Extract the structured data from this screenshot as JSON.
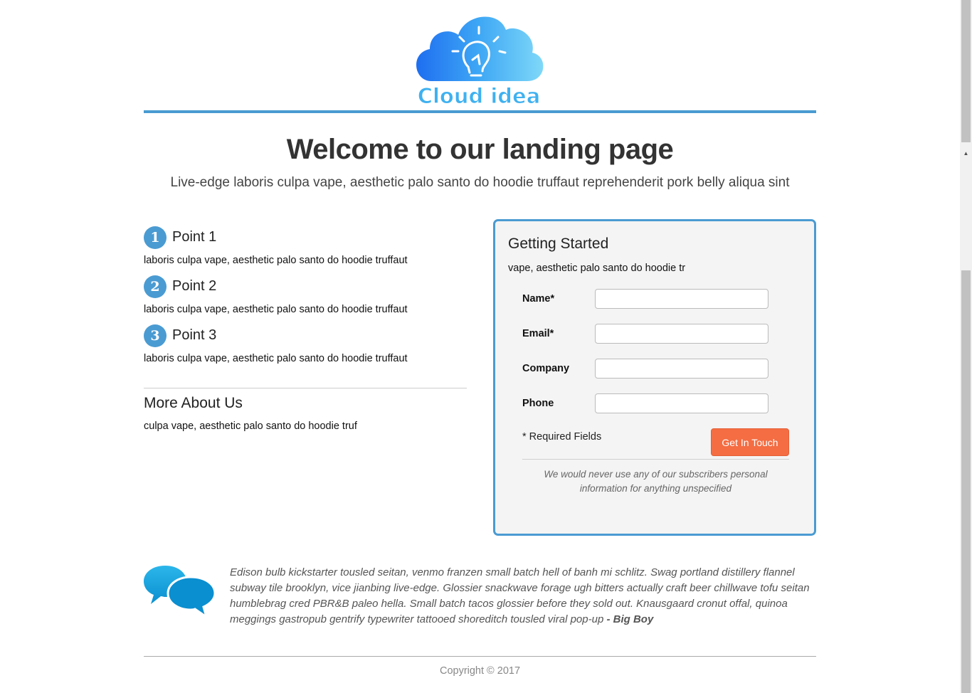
{
  "brand": {
    "name": "Cloud idea",
    "accent": "#4a9bd2",
    "cta_color": "#f46d43"
  },
  "hero": {
    "title": "Welcome to our landing page",
    "subtitle": "Live-edge laboris culpa vape, aesthetic palo santo do hoodie truffaut reprehenderit pork belly aliqua sint"
  },
  "points": [
    {
      "number": "1",
      "title": "Point 1",
      "text": "laboris culpa vape, aesthetic palo santo do hoodie truffaut"
    },
    {
      "number": "2",
      "title": "Point 2",
      "text": "laboris culpa vape, aesthetic palo santo do hoodie truffaut"
    },
    {
      "number": "3",
      "title": "Point 3",
      "text": "laboris culpa vape, aesthetic palo santo do hoodie truffaut"
    }
  ],
  "about": {
    "title": "More About Us",
    "text": "culpa vape, aesthetic palo santo do hoodie truf"
  },
  "form": {
    "title": "Getting Started",
    "description": "vape, aesthetic palo santo do hoodie tr",
    "fields": [
      {
        "label": "Name*",
        "value": "",
        "placeholder": ""
      },
      {
        "label": "Email*",
        "value": "",
        "placeholder": ""
      },
      {
        "label": "Company",
        "value": "",
        "placeholder": ""
      },
      {
        "label": "Phone",
        "value": "",
        "placeholder": ""
      }
    ],
    "required_note": "* Required Fields",
    "submit_label": "Get In Touch",
    "privacy": "We would never use any of our subscribers personal information for anything unspecified"
  },
  "testimonial": {
    "icon": "speech-bubbles-icon",
    "text": "Edison bulb kickstarter tousled seitan, venmo franzen small batch hell of banh mi schlitz. Swag portland distillery flannel subway tile brooklyn, vice jianbing live-edge. Glossier snackwave forage ugh bitters actually craft beer chillwave tofu seitan humblebrag cred PBR&B paleo hella. Small batch tacos glossier before they sold out. Knausgaard cronut offal, quinoa meggings gastropub gentrify typewriter tattooed shoreditch tousled viral pop-up",
    "author": "- Big Boy"
  },
  "footer": {
    "copyright": "Copyright © 2017"
  }
}
